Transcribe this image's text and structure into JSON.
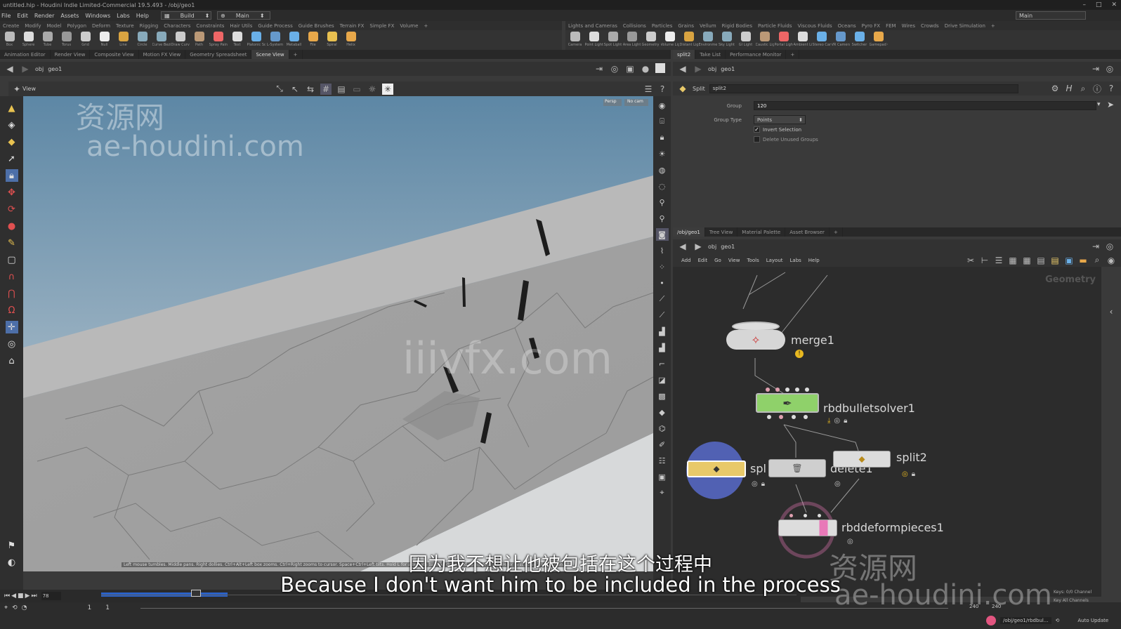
{
  "window": {
    "title": "untitled.hip - Houdini Indie Limited-Commercial 19.5.493 - /obj/geo1",
    "controls": [
      "–",
      "□",
      "✕"
    ]
  },
  "menubar": {
    "items": [
      "File",
      "Edit",
      "Render",
      "Assets",
      "Windows",
      "Labs",
      "Help"
    ],
    "desktop": "Build",
    "workspace": "Main",
    "right_dd": "Main"
  },
  "shelf_left": {
    "tabs": [
      "Create",
      "Modify",
      "Model",
      "Polygon",
      "Deform",
      "Texture",
      "Rigging",
      "Characters",
      "Constraints",
      "Hair Utils",
      "Guide Process",
      "Guide Brushes",
      "Terrain FX",
      "Simple FX",
      "Volume"
    ],
    "tools": [
      "Box",
      "Sphere",
      "Tube",
      "Torus",
      "Grid",
      "Null",
      "Line",
      "Circle",
      "Curve Bezier",
      "Draw Curve",
      "Path",
      "Spray Paint",
      "Text",
      "Platonic Solids",
      "L-System",
      "Metaball",
      "File",
      "Spiral",
      "Helix"
    ]
  },
  "shelf_right": {
    "tabs": [
      "Lights and Cameras",
      "Collisions",
      "Particles",
      "Grains",
      "Vellum",
      "Rigid Bodies",
      "Particle Fluids",
      "Viscous Fluids",
      "Oceans",
      "Pyro FX",
      "FEM",
      "Wires",
      "Crowds",
      "Drive Simulation"
    ],
    "tools": [
      "Camera",
      "Point Light",
      "Spot Light",
      "Area Light",
      "Geometry Light",
      "Volume Light",
      "Distant Light",
      "Environment Light",
      "Sky Light",
      "GI Light",
      "Caustic Light",
      "Portal Light",
      "Ambient Light",
      "Stereo Camera",
      "VR Camera",
      "Switcher",
      "Gamepad Camera"
    ]
  },
  "left_pane": {
    "tabs": [
      "Animation Editor",
      "Render View",
      "Composite View",
      "Motion FX View",
      "Geometry Spreadsheet",
      "Scene View"
    ],
    "path": [
      "obj",
      "geo1"
    ],
    "view_label": "View",
    "persp": "Persp",
    "cam": "No cam"
  },
  "params_pane": {
    "tabs": [
      "split2",
      "Take List",
      "Performance Monitor"
    ],
    "path": [
      "obj",
      "geo1"
    ],
    "node_type": "Split",
    "node_name": "split2",
    "group_label": "Group",
    "group_value": "120",
    "group_type_label": "Group Type",
    "group_type_value": "Points",
    "invert_label": "Invert Selection",
    "invert_checked": true,
    "delete_label": "Delete Unused Groups",
    "delete_checked": false
  },
  "network_pane": {
    "tabs": [
      "/obj/geo1",
      "Tree View",
      "Material Palette",
      "Asset Browser"
    ],
    "path": [
      "obj",
      "geo1"
    ],
    "menu": [
      "Add",
      "Edit",
      "Go",
      "View",
      "Tools",
      "Layout",
      "Labs",
      "Help"
    ],
    "context_label": "Geometry",
    "nodes": {
      "merge": "merge1",
      "solver": "rbdbulletsolver1",
      "split_left": "spl",
      "delete": "delete1",
      "split_right": "split2",
      "deform": "rbddeformpieces1"
    }
  },
  "viewport_hint": "Left mouse tumbles. Middle pans. Right dollies. Ctrl+Alt+Left box zooms. Ctrl+Right zooms to cursor. Space+Ctrl+Left tilts. Hold L for alternate tumble, dolly, and zoom.   M or Alt+M for First Person Navigation.",
  "timeline": {
    "frame": "78",
    "start": "1",
    "end": "1",
    "range_end": "240",
    "range_end2": "240"
  },
  "statusbar": {
    "path": "/obj/geo1/rbdbul...",
    "auto_update": "Auto Update",
    "keys": "Keys: 0/0 Channel",
    "key_all": "Key All Channels"
  },
  "subtitle": {
    "zh": "因为我不想让他被包括在这个过程中",
    "en": "Because I don't want him to be included in the process"
  },
  "watermarks": {
    "top_zh": "资源网",
    "top_en": "ae-houdini.com",
    "center": "iiivfx.com",
    "bottom_zh": "资源网",
    "bottom_en": "ae-houdini.com"
  },
  "colors": {
    "solver_node": "#8fd16a",
    "split_node": "#e8c96a",
    "deform_node": "#e879b8",
    "viewport_sky": "#5d87a5",
    "wall": "#a9a9a9"
  }
}
